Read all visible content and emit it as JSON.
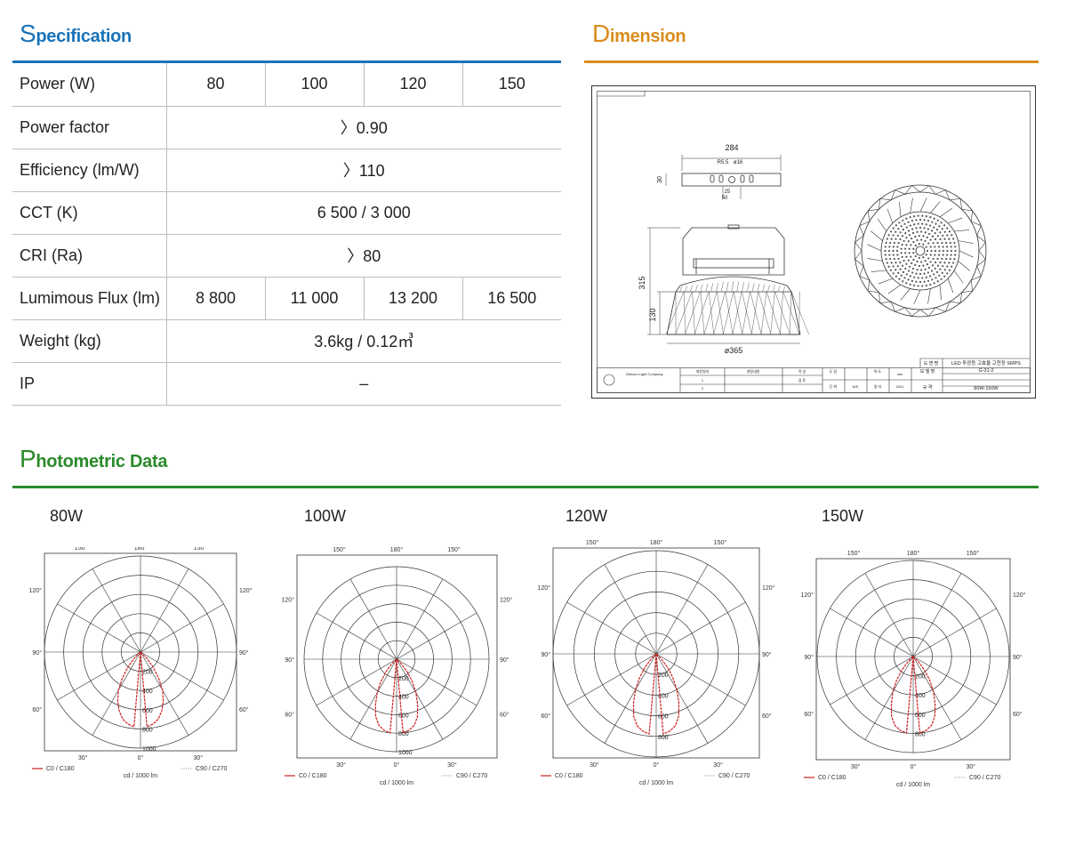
{
  "sections": {
    "specification": {
      "cap": "S",
      "rest": "pecification"
    },
    "dimension": {
      "cap": "D",
      "rest": "imension"
    },
    "photometric": {
      "cap": "P",
      "rest": "hotometric Data"
    }
  },
  "spec": {
    "rows": [
      {
        "label": "Power (W)",
        "values": [
          "80",
          "100",
          "120",
          "150"
        ]
      },
      {
        "label": "Power factor",
        "values": [
          "〉0.90"
        ]
      },
      {
        "label": "Efficiency (lm/W)",
        "values": [
          "〉110"
        ]
      },
      {
        "label": "CCT (K)",
        "values": [
          "6 500 / 3 000"
        ]
      },
      {
        "label": "CRI (Ra)",
        "values": [
          "〉80"
        ]
      },
      {
        "label": "Lumimous Flux (lm)",
        "values": [
          "8 800",
          "11 000",
          "13 200",
          "16 500"
        ]
      },
      {
        "label": "Weight (kg)",
        "values": [
          "3.6kg / 0.12㎥"
        ]
      },
      {
        "label": "IP",
        "values": [
          "–"
        ]
      }
    ]
  },
  "dimension": {
    "width_top": "284",
    "r55": "R5.5",
    "phi16": "ø16",
    "d25": "25",
    "d50": "50",
    "d30": "30",
    "height_total": "315",
    "height_lower": "130",
    "diameter": "ø365",
    "title_block": {
      "drawing_name_label": "도 면 명",
      "drawing_name": "LED 투광등 고효율 고천정 SMPS",
      "model_label": "모 델 명",
      "model": "G-31-2",
      "spec_label": "규 격",
      "spec": "80W-150W",
      "company": "Elecom Light Company",
      "unit": "mm",
      "scale": "N/S",
      "year": "2021",
      "rev1": "1",
      "rev2": "2",
      "date_hdr": "개정일자",
      "content_hdr": "개정내용",
      "check_label": "작 성",
      "approve_label": "검 토",
      "sign_label": "도 장",
      "unit_label": "단 위",
      "scale_label": "척 도",
      "year_label": "일 자"
    }
  },
  "photometric": {
    "charts": [
      {
        "label": "80W",
        "profile": [
          0,
          780,
          760,
          720,
          650,
          560,
          460,
          330,
          200,
          90,
          0
        ],
        "rings": [
          "200",
          "400",
          "600",
          "800",
          "1000"
        ],
        "ringmax": 1000
      },
      {
        "label": "100W",
        "profile": [
          0,
          800,
          780,
          740,
          660,
          540,
          420,
          300,
          180,
          80,
          0
        ],
        "rings": [
          "200",
          "400",
          "600",
          "800",
          "1000"
        ],
        "ringmax": 1000
      },
      {
        "label": "120W",
        "profile": [
          0,
          780,
          760,
          720,
          640,
          520,
          400,
          280,
          170,
          70,
          0
        ],
        "rings": [
          "200",
          "400",
          "600",
          "800"
        ],
        "ringmax": 1000
      },
      {
        "label": "150W",
        "profile": [
          0,
          800,
          780,
          740,
          660,
          540,
          420,
          300,
          180,
          80,
          0
        ],
        "rings": [
          "200",
          "400",
          "600",
          "800"
        ],
        "ringmax": 1000
      }
    ],
    "angles": {
      "a150": "150°",
      "a180": "180°",
      "a120": "120°",
      "a90": "90°",
      "a60": "60°",
      "a30": "30°",
      "a0": "0°"
    },
    "legend": {
      "c0": "C0 / C180",
      "c90": "C90 / C270",
      "unit": "cd / 1000 lm"
    },
    "colors": {
      "c0": "#cc1f1f",
      "grid": "#333333"
    }
  }
}
